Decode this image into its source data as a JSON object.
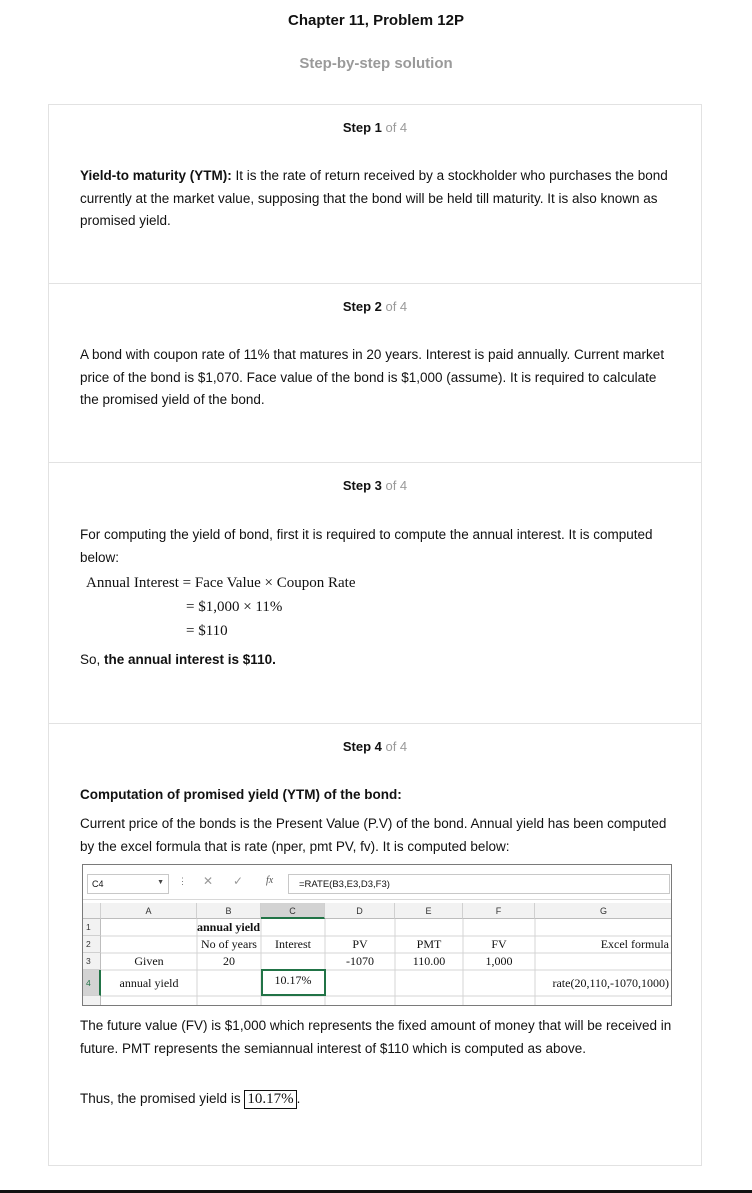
{
  "header": {
    "title": "Chapter 11, Problem 12P",
    "subtitle": "Step-by-step solution"
  },
  "steps": [
    {
      "label": "Step 1",
      "of": " of 4",
      "bold_term": "Yield-to maturity (YTM):",
      "text": " It is the rate of return received by a stockholder who purchases the bond currently at the market value, supposing that the bond will be held till maturity. It is also known as promised yield."
    },
    {
      "label": "Step 2",
      "of": " of 4",
      "text": "A bond with coupon rate of 11% that matures in 20 years. Interest is paid annually. Current market price of the bond is $1,070. Face value of the bond is $1,000 (assume). It is required to calculate the promised yield of the bond."
    },
    {
      "label": "Step 3",
      "of": " of 4",
      "text": "For computing the yield of bond, first it is required to compute the annual interest. It is computed below:",
      "math": {
        "line1": "Annual Interest = Face Value × Coupon Rate",
        "line2": "= $1,000 × 11%",
        "line3": "= $110"
      },
      "conclusion_prefix": "So, ",
      "conclusion_bold": "the annual interest is $110."
    },
    {
      "label": "Step 4",
      "of": " of 4",
      "heading": "Computation of promised yield (YTM) of the bond:",
      "text": "Current price of the bonds is the Present Value (P.V) of the bond. Annual yield has been computed by the excel formula that is rate (nper, pmt PV, fv). It is computed below:",
      "text2": "The future value (FV) is $1,000 which represents the fixed amount of money that will be received in future. PMT represents the semiannual interest of $110 which is computed as above.",
      "final_prefix": "Thus, the promised yield is ",
      "final_value": "10.17%",
      "final_suffix": "."
    }
  ],
  "excel": {
    "name_box": "C4",
    "formula": "=RATE(B3,E3,D3,F3)",
    "fx": "fx",
    "columns": [
      "A",
      "B",
      "C",
      "D",
      "E",
      "F",
      "G"
    ],
    "rows": [
      "1",
      "2",
      "3",
      "4"
    ],
    "cells": {
      "B1": "annual yield",
      "B2": "No of years",
      "C2": "Interest",
      "D2": "PV",
      "E2": "PMT",
      "F2": "FV",
      "G2": "Excel formula",
      "A3": "Given",
      "B3": "20",
      "D3": "-1070",
      "E3": "110.00",
      "F3": "1,000",
      "A4": "annual yield",
      "C4": "10.17%",
      "G4": "rate(20,110,-1070,1000)"
    }
  }
}
